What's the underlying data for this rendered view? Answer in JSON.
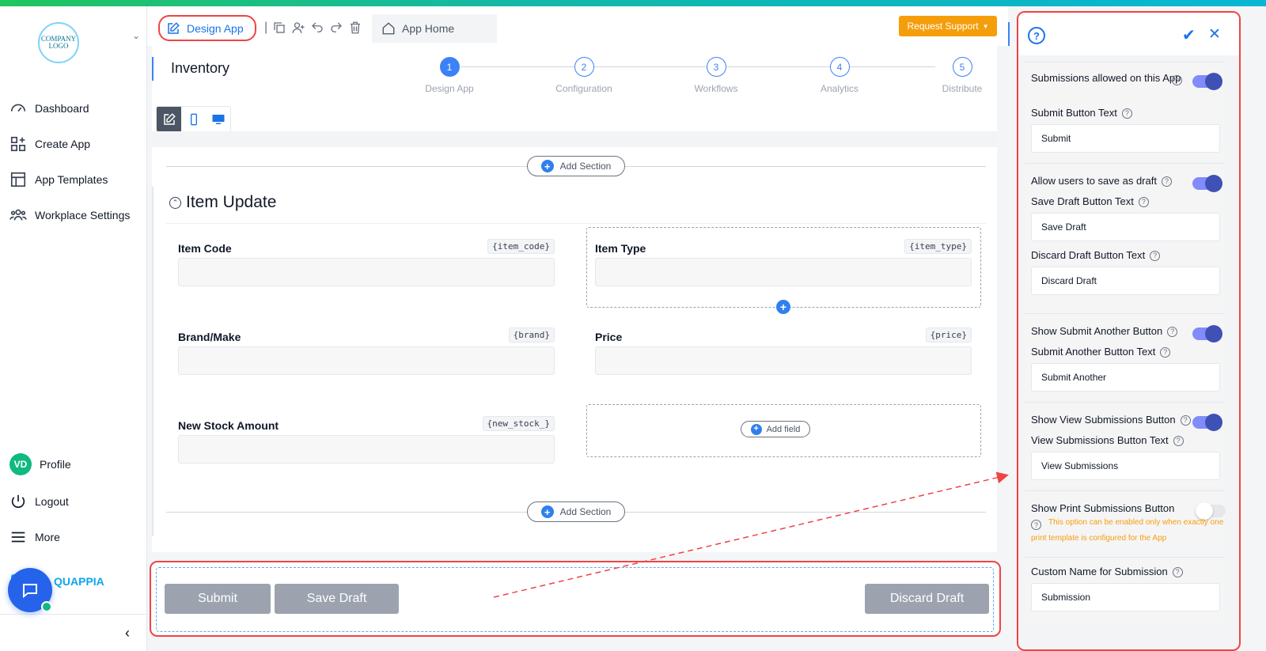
{
  "sidebar": {
    "logo_text": "COMPANY LOGO",
    "nav": [
      {
        "label": "Dashboard"
      },
      {
        "label": "Create App"
      },
      {
        "label": "App Templates"
      },
      {
        "label": "Workplace Settings"
      }
    ],
    "profile": {
      "initials": "VD",
      "label": "Profile"
    },
    "logout": "Logout",
    "more": "More",
    "brand": "QUAPPIA"
  },
  "header": {
    "design_app": "Design App",
    "app_home": "App Home",
    "request_support": "Request Support"
  },
  "main": {
    "app_title": "Inventory",
    "steps": [
      {
        "num": "1",
        "label": "Design App"
      },
      {
        "num": "2",
        "label": "Configuration"
      },
      {
        "num": "3",
        "label": "Workflows"
      },
      {
        "num": "4",
        "label": "Analytics"
      },
      {
        "num": "5",
        "label": "Distribute"
      }
    ],
    "add_section": "Add Section",
    "section_title": "Item Update",
    "fields": [
      {
        "label": "Item Code",
        "var": "{item_code}"
      },
      {
        "label": "Item Type",
        "var": "{item_type}"
      },
      {
        "label": "Brand/Make",
        "var": "{brand}"
      },
      {
        "label": "Price",
        "var": "{price}"
      },
      {
        "label": "New Stock Amount",
        "var": "{new_stock_}"
      }
    ],
    "add_field": "Add field"
  },
  "actions": {
    "submit": "Submit",
    "save_draft": "Save Draft",
    "discard_draft": "Discard Draft"
  },
  "panel": {
    "submissions_allowed": "Submissions allowed on this App",
    "submit_button_text_label": "Submit Button Text",
    "submit_button_text": "Submit",
    "allow_draft": "Allow users to save as draft",
    "save_draft_label": "Save Draft Button Text",
    "save_draft_text": "Save Draft",
    "discard_draft_label": "Discard Draft Button Text",
    "discard_draft_text": "Discard Draft",
    "show_submit_another": "Show Submit Another Button",
    "submit_another_label": "Submit Another Button Text",
    "submit_another_text": "Submit Another",
    "show_view_submissions": "Show View Submissions Button",
    "view_submissions_label": "View Submissions Button Text",
    "view_submissions_text": "View Submissions",
    "show_print": "Show Print Submissions Button",
    "print_warning": "This option can be enabled only when exactly one print template is configured for the App",
    "custom_name_label": "Custom Name for Submission",
    "custom_name_text": "Submission"
  },
  "colors": {
    "accent": "#1a73e8",
    "highlight": "#ef4444",
    "support": "#f59e0b",
    "toggle_on": "#3f51b5"
  }
}
